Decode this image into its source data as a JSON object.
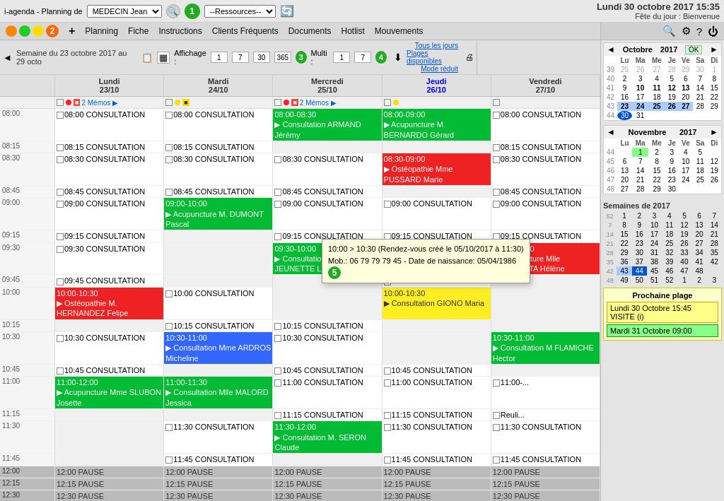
{
  "topbar": {
    "title": "i-agenda - Planning de",
    "doctor": "MEDECIN Jean",
    "resources_label": "--Ressources--",
    "num1": "1",
    "datetime": "Lundi 30 octobre 2017  15:35",
    "fete": "Fête du jour : Bienvenue"
  },
  "iconbar": {
    "nav_items": [
      "Planning",
      "Fiche",
      "Instructions",
      "Clients Fréquents",
      "Documents",
      "Hotlist",
      "Mouvements"
    ],
    "add_icon": "+",
    "icons": [
      "⚙",
      "?",
      "⏻"
    ]
  },
  "weekbar": {
    "week_label": "Semaine du 23 octobre 2017 au 29 octo",
    "affichage_label": "Affichage :",
    "val1": "1",
    "val7": "7",
    "val30": "30",
    "val365": "365",
    "multi_label": "Multi :",
    "mval1": "1",
    "mval7": "7",
    "tous_jours": "Tous les jours",
    "plages_dispo": "Plages disponibles",
    "mode_reduit": "Mode réduit",
    "num3": "3",
    "num4": "4"
  },
  "days": [
    {
      "label": "Lundi",
      "date": "23/10",
      "today": false
    },
    {
      "label": "Mardi",
      "date": "24/10",
      "today": false
    },
    {
      "label": "Mercredi",
      "date": "25/10",
      "today": false
    },
    {
      "label": "Jeudi",
      "date": "26/10",
      "today": false
    },
    {
      "label": "Vendredi",
      "date": "27/10",
      "today": false
    }
  ],
  "tooltip": {
    "time": "10:00 > 10:30 (Rendez-vous créé le 05/10/2017 à 11:30)",
    "mob": "Mob.: 06 79 79 79 45 - Date de naissance: 05/04/1986"
  },
  "sidebar": {
    "october_label": "Octobre",
    "october_year": "2017",
    "november_label": "Novembre",
    "november_year": "2017",
    "semaines_label": "Semaines de 2017",
    "prochaine_label": "Prochaine plage",
    "slot1_label": "Lundi 30 Octobre 15:45",
    "slot1_type": "VISITE (i)",
    "slot2_label": "Mardi 31 Octobre 09:00",
    "week_days_short": [
      "Lu",
      "Ma",
      "Me",
      "Je",
      "Ve",
      "Sa",
      "Di"
    ]
  }
}
